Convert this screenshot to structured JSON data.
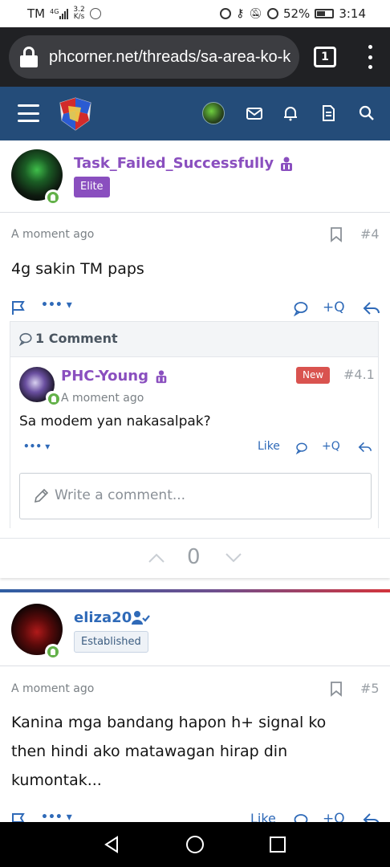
{
  "status_bar": {
    "carrier": "TM",
    "network": "4G",
    "speed_value": "3.2",
    "speed_unit": "K/s",
    "battery": "52%",
    "time": "3:14"
  },
  "browser": {
    "url": "phcorner.net/threads/sa-area-ko-k",
    "tab_count": "1"
  },
  "post1": {
    "username": "Task_Failed_Successfully",
    "rank": "Elite",
    "time": "A moment ago",
    "number": "#4",
    "body": "4g sakin TM paps",
    "actions": {
      "more": "•••",
      "quote": "+Q"
    },
    "comments": {
      "header": "1 Comment",
      "items": [
        {
          "username": "PHC-Young",
          "badge": "New",
          "number": "#4.1",
          "time": "A moment ago",
          "body": "Sa modem yan nakasalpak?",
          "like": "Like",
          "quote": "+Q",
          "more": "•••"
        }
      ],
      "write_placeholder": "Write a comment..."
    },
    "vote_count": "0"
  },
  "post2": {
    "username": "eliza20",
    "rank": "Established",
    "time": "A moment ago",
    "number": "#5",
    "body_lines": [
      "Kanina mga bandang hapon h+ signal ko",
      "then hindi ako matawagan hirap din",
      "kumontak..."
    ],
    "actions": {
      "more": "•••",
      "like": "Like",
      "quote": "+Q"
    }
  },
  "colors": {
    "header_bg": "#244c79",
    "browser_bg": "#202124",
    "elite_purple": "#8a4fbf",
    "established_blue": "#2f6ab8",
    "new_badge": "#d9534f",
    "online_green": "#63b149"
  },
  "icons": [
    "lock-icon",
    "hamburger-icon",
    "mail-icon",
    "bell-icon",
    "document-icon",
    "search-icon",
    "bookmark-icon",
    "flag-icon",
    "comment-icon",
    "reply-icon",
    "pencil-icon",
    "arrow-up-icon",
    "arrow-down-icon"
  ]
}
